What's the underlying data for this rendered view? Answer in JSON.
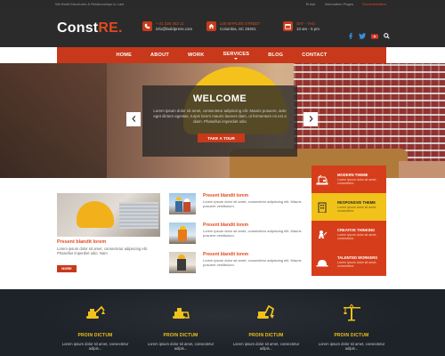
{
  "topbar": {
    "tagline": "We Build Structures & Relationships to Last",
    "links": [
      "Entrar",
      "Information Pages",
      "Documentation"
    ]
  },
  "brand": {
    "name": "Const",
    "accent": "RE."
  },
  "contacts": [
    {
      "icon": "phone-icon",
      "line1": "+ 01 326 452 11",
      "line2": "info@buildpress.com"
    },
    {
      "icon": "home-icon",
      "line1": "140 MAPLEN STREET",
      "line2": "Columbia, SC 29201"
    },
    {
      "icon": "calendar-icon",
      "line1": "SAT - THU",
      "line2": "10 am - 5 pm"
    }
  ],
  "social": [
    "facebook-icon",
    "twitter-icon",
    "youtube-icon",
    "search-icon"
  ],
  "nav": [
    "HOME",
    "ABOUT",
    "WORK",
    "SERVICES",
    "BLOG",
    "CONTACT"
  ],
  "hero": {
    "title": "WELCOME",
    "text": "Lorem ipsum dolor sit amet, consectetur adipiscing elit. Mauris posuere, ante eget dictum egestas, turpis lorem mauris laoreet diam, ut fermentum mi est a diam. Phasellus imperdiet odio",
    "button": "TAKE A TOUR"
  },
  "features": [
    {
      "icon": "crane-icon",
      "title": "MODERN THEME",
      "text": "Lorem ipsum dolor sit amet, consectetur"
    },
    {
      "icon": "building-icon",
      "title": "RESPONSIVE THEME",
      "text": "Lorem ipsum dolor sit amet, consectetur"
    },
    {
      "icon": "worker-icon",
      "title": "CREATIVE THINKING",
      "text": "Lorem ipsum dolor sit amet, consectetur"
    },
    {
      "icon": "helmet-icon",
      "title": "TALENTED WORKERS",
      "text": "Lorem ipsum dolor sit amet, consectetur"
    }
  ],
  "main_article": {
    "title": "Present blandit lorem",
    "text": "Lorem ipsum dolor sit amet, consectetur adipiscing elit. Phasellus imperdiet odio. Nam",
    "button": "MORE"
  },
  "news": [
    {
      "title": "Present blandit lorem",
      "text": "Lorem ipsum dolor sit amet, consectetur adipiscing elit. Mauris posuere vestibulum."
    },
    {
      "title": "Present blandit lorem",
      "text": "Lorem ipsum dolor sit amet, consectetur adipiscing elit. Mauris posuere vestibulum."
    },
    {
      "title": "Present blandit lorem",
      "text": "Lorem ipsum dolor sit amet, consectetur adipiscing elit. Mauris posuere vestibulum."
    }
  ],
  "services": [
    {
      "icon": "excavator-icon",
      "title": "PROIN DICTUM",
      "text": "Lorem ipsum dolor sit amet, consectetur adipis..."
    },
    {
      "icon": "bulldozer-icon",
      "title": "PROIN DICTUM",
      "text": "Lorem ipsum dolor sit amet, consectetur adipis..."
    },
    {
      "icon": "digger-icon",
      "title": "PROIN DICTUM",
      "text": "Lorem ipsum dolor sit amet, consectetur adipis..."
    },
    {
      "icon": "tower-crane-icon",
      "title": "PROIN DICTUM",
      "text": "Lorem ipsum dolor sit amet, consectetur adipis..."
    }
  ],
  "colors": {
    "accent": "#c8381a",
    "yellow": "#f0c21a",
    "dark": "#2b2b2b"
  }
}
